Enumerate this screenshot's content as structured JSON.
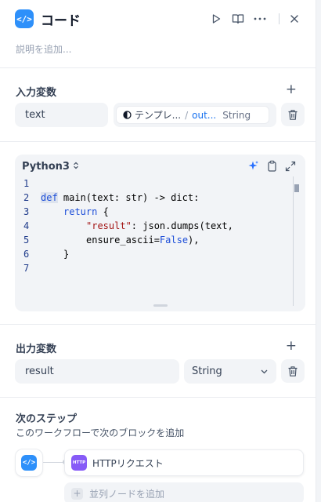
{
  "header": {
    "node_icon": "code-icon",
    "title": "コード",
    "actions": [
      "play-icon",
      "book-icon",
      "more-icon",
      "close-icon"
    ]
  },
  "description_placeholder": "説明を追加...",
  "input_section": {
    "title": "入力変数",
    "variables": [
      {
        "name": "text",
        "source_node": "テンプレ...",
        "separator": "/",
        "source_var": "out...",
        "type": "String"
      }
    ]
  },
  "code_editor": {
    "language": "Python3",
    "lines": [
      {
        "num": "1"
      },
      {
        "num": "2"
      },
      {
        "num": "3"
      },
      {
        "num": "4"
      },
      {
        "num": "5"
      },
      {
        "num": "6"
      },
      {
        "num": "7"
      }
    ],
    "tokens": {
      "def": "def",
      "main": " main(text: str) -> dict:",
      "return": "return",
      "return_brace": " {",
      "result_key": "\"result\"",
      "line4_rest": ": json.dumps(text,",
      "ensure": "ensure_ascii=",
      "false": "False",
      "line5_rest": "),",
      "close_brace": "}"
    }
  },
  "output_section": {
    "title": "出力変数",
    "variables": [
      {
        "name": "result",
        "type": "String"
      }
    ]
  },
  "next_step": {
    "title": "次のステップ",
    "subtitle": "このワークフローで次のブロックを追加",
    "next_node_icon_text": "HTTP",
    "next_node_label": "HTTPリクエスト",
    "add_parallel": "並列ノードを追加"
  },
  "colors": {
    "accent_blue": "#2e90fa",
    "http_purple": "#875bf7"
  }
}
